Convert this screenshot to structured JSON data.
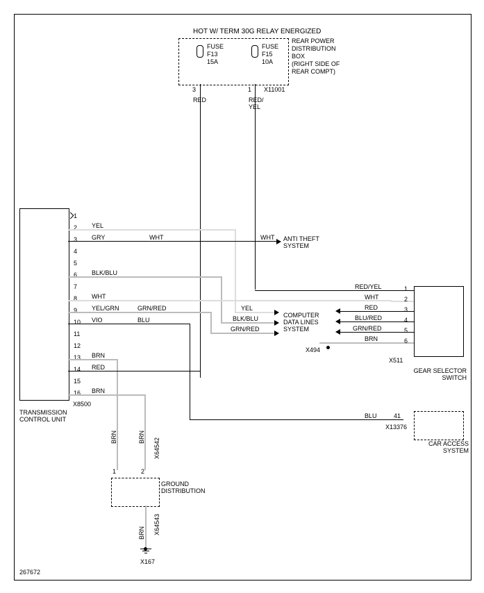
{
  "title": "HOT W/ TERM 30G RELAY ENERGIZED",
  "boxes": {
    "rear_power": {
      "lines": [
        "REAR POWER",
        "DISTRIBUTION",
        "BOX",
        "(RIGHT SIDE OF",
        "REAR COMPT)"
      ]
    },
    "tcu": {
      "name": "TRANSMISSION CONTROL UNIT",
      "conn": "X8500"
    },
    "gss": {
      "name": "GEAR SELECTOR SWITCH",
      "conn": "X511"
    },
    "cas": {
      "name": "CAR ACCESS SYSTEM",
      "conn": "X13376"
    },
    "ground": {
      "name": "GROUND DISTRIBUTION"
    }
  },
  "fuses": {
    "f13": {
      "label": "FUSE",
      "name": "F13",
      "rating": "15A",
      "pin": "3"
    },
    "f15": {
      "label": "FUSE",
      "name": "F15",
      "rating": "10A",
      "pin": "1",
      "conn": "X11001"
    }
  },
  "tcu_pins": [
    "1",
    "2",
    "3",
    "4",
    "5",
    "6",
    "7",
    "8",
    "9",
    "10",
    "11",
    "12",
    "13",
    "14",
    "15",
    "16"
  ],
  "tcu_wires": {
    "2": "YEL",
    "3": "GRY",
    "3b": "WHT",
    "6": "BLK/BLU",
    "8": "WHT",
    "9": "YEL/GRN",
    "9b": "GRN/RED",
    "10": "VIO",
    "10b": "BLU",
    "13": "BRN",
    "14": "RED",
    "16": "BRN"
  },
  "gss_pins": {
    "1": "RED/YEL",
    "2": "WHT",
    "3": "RED",
    "4": "BLU/RED",
    "5": "GRN/RED",
    "6": "BRN"
  },
  "mid_labels": {
    "wht": "WHT",
    "yel": "YEL",
    "blkblu": "BLK/BLU",
    "grnred": "GRN/RED"
  },
  "systems": {
    "antitheft": "ANTI THEFT SYSTEM",
    "cdl": "COMPUTER DATA LINES SYSTEM"
  },
  "top_colors": {
    "red": "RED",
    "redyel": "RED/ YEL"
  },
  "cas_wire": {
    "color": "BLU",
    "pin": "41"
  },
  "ground_refs": {
    "x64542": "X64542",
    "x64543": "X64543",
    "x167": "X167",
    "brn": "BRN",
    "pins": [
      "1",
      "2"
    ]
  },
  "x494": "X494",
  "doc_id": "267672"
}
